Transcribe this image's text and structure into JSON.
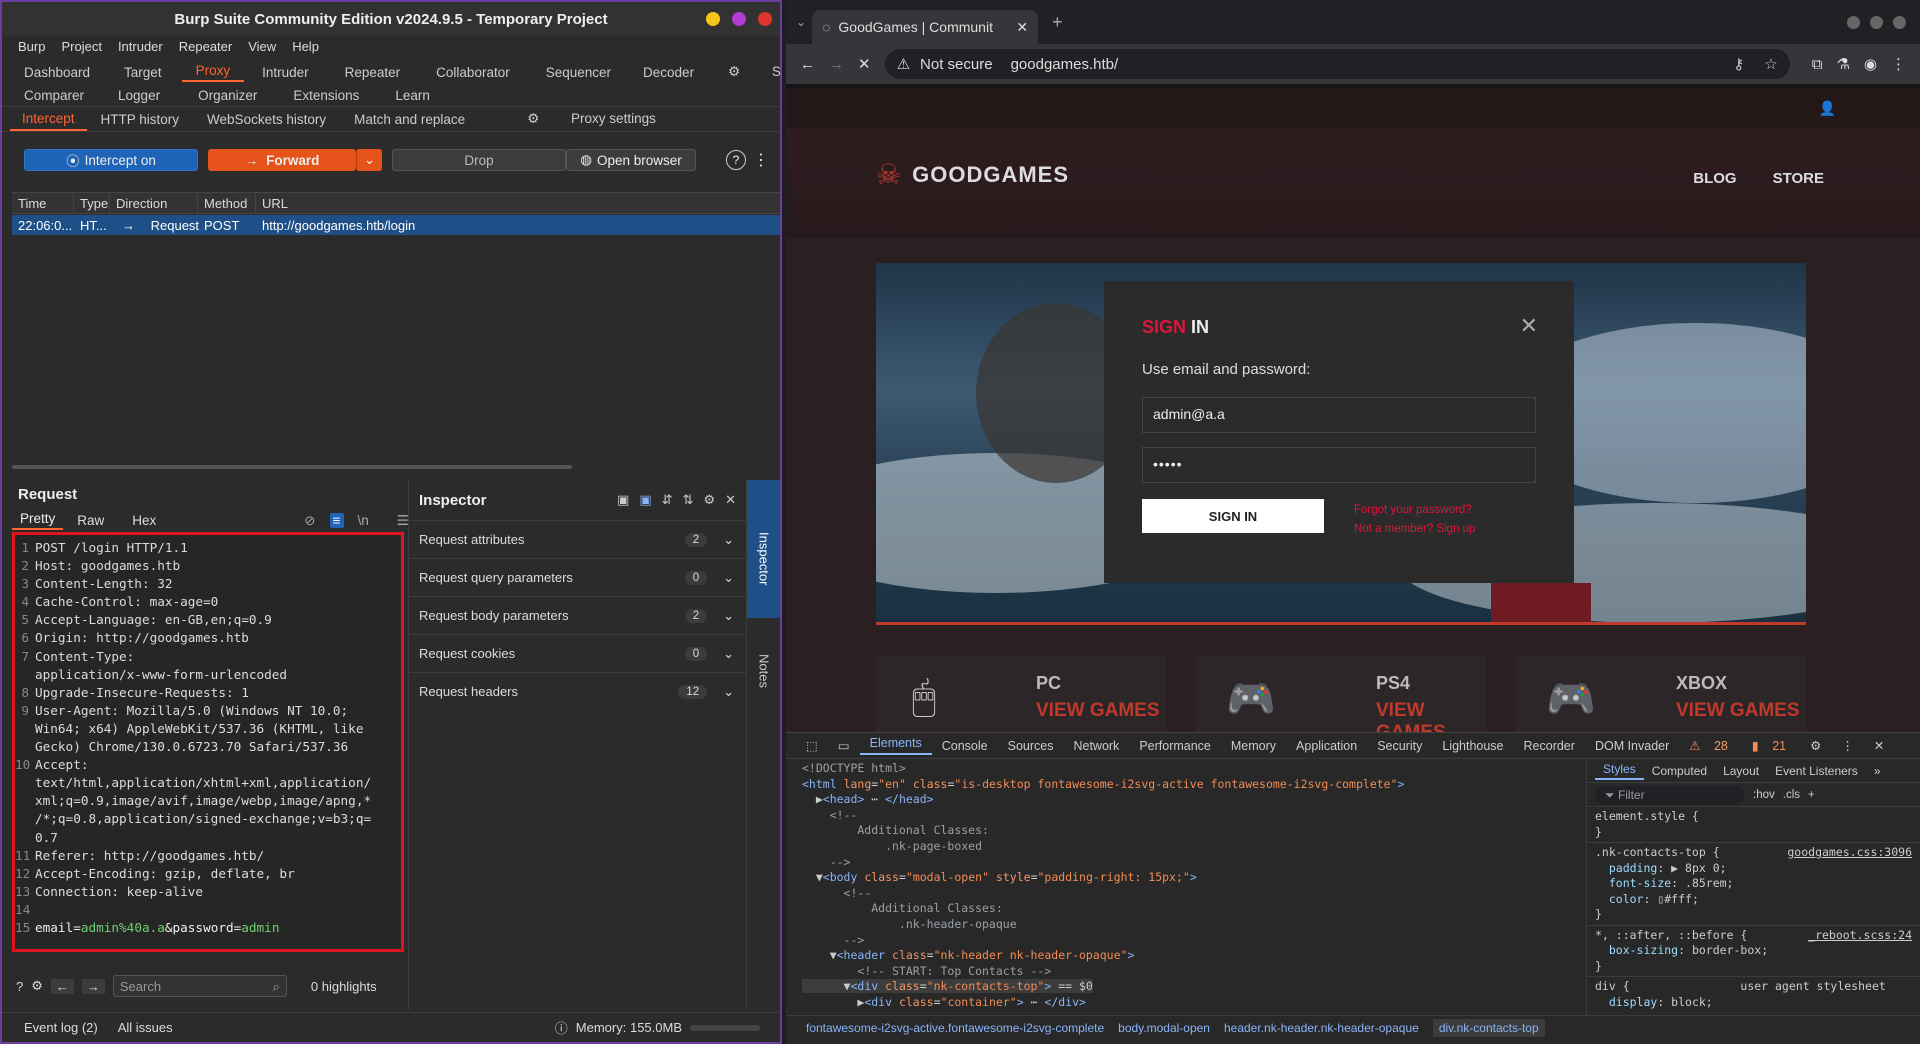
{
  "burp": {
    "title": "Burp Suite Community Edition v2024.9.5 - Temporary Project",
    "menu": [
      "Burp",
      "Project",
      "Intruder",
      "Repeater",
      "View",
      "Help"
    ],
    "tabs_row1": [
      "Dashboard",
      "Target",
      "Proxy",
      "Intruder",
      "Repeater",
      "Collaborator",
      "Sequencer",
      "Decoder"
    ],
    "settings_label": "Settings",
    "tabs_row2": [
      "Comparer",
      "Logger",
      "Organizer",
      "Extensions",
      "Learn"
    ],
    "subtabs": [
      "Intercept",
      "HTTP history",
      "WebSockets history",
      "Match and replace"
    ],
    "proxy_settings_label": "Proxy settings",
    "intercept_label": "Intercept on",
    "forward_label": "Forward",
    "drop_label": "Drop",
    "open_browser_label": "Open browser",
    "table": {
      "headers": [
        "Time",
        "Type",
        "Direction",
        "Method",
        "URL"
      ],
      "row": {
        "time": "22:06:0...",
        "type": "HT...",
        "direction": "Request",
        "method": "POST",
        "url": "http://goodgames.htb/login"
      }
    },
    "request": {
      "title": "Request",
      "tabs": [
        "Pretty",
        "Raw",
        "Hex"
      ],
      "lines": [
        {
          "n": "1",
          "text": "POST /login HTTP/1.1"
        },
        {
          "n": "2",
          "text": "Host: goodgames.htb"
        },
        {
          "n": "3",
          "text": "Content-Length: 32"
        },
        {
          "n": "4",
          "text": "Cache-Control: max-age=0"
        },
        {
          "n": "5",
          "text": "Accept-Language: en-GB,en;q=0.9"
        },
        {
          "n": "6",
          "text": "Origin: http://goodgames.htb"
        },
        {
          "n": "7",
          "text": "Content-Type:"
        },
        {
          "n": "",
          "text": "application/x-www-form-urlencoded"
        },
        {
          "n": "8",
          "text": "Upgrade-Insecure-Requests: 1"
        },
        {
          "n": "9",
          "text": "User-Agent: Mozilla/5.0 (Windows NT 10.0;"
        },
        {
          "n": "",
          "text": "Win64; x64) AppleWebKit/537.36 (KHTML, like"
        },
        {
          "n": "",
          "text": "Gecko) Chrome/130.0.6723.70 Safari/537.36"
        },
        {
          "n": "10",
          "text": "Accept:"
        },
        {
          "n": "",
          "text": "text/html,application/xhtml+xml,application/"
        },
        {
          "n": "",
          "text": "xml;q=0.9,image/avif,image/webp,image/apng,*"
        },
        {
          "n": "",
          "text": "/*;q=0.8,application/signed-exchange;v=b3;q="
        },
        {
          "n": "",
          "text": "0.7"
        },
        {
          "n": "11",
          "text": "Referer: http://goodgames.htb/"
        },
        {
          "n": "12",
          "text": "Accept-Encoding: gzip, deflate, br"
        },
        {
          "n": "13",
          "text": "Connection: keep-alive"
        },
        {
          "n": "14",
          "text": ""
        }
      ],
      "body_line": {
        "n": "15",
        "p1": "email=",
        "v1": "admin%40a.a",
        "p2": "&password=",
        "v2": "admin"
      },
      "search_placeholder": "Search",
      "highlights": "0 highlights"
    },
    "inspector": {
      "title": "Inspector",
      "rows": [
        {
          "label": "Request attributes",
          "count": "2"
        },
        {
          "label": "Request query parameters",
          "count": "0"
        },
        {
          "label": "Request body parameters",
          "count": "2"
        },
        {
          "label": "Request cookies",
          "count": "0"
        },
        {
          "label": "Request headers",
          "count": "12"
        }
      ],
      "side_inspector": "Inspector",
      "side_notes": "Notes"
    },
    "status": {
      "event_log": "Event log (2)",
      "all_issues": "All issues",
      "memory": "Memory: 155.0MB"
    }
  },
  "chrome": {
    "tab_title": "GoodGames | Communit",
    "not_secure": "Not secure",
    "url": "goodgames.htb/",
    "site": {
      "logo": "GOODGAMES",
      "nav": [
        "BLOG",
        "STORE"
      ],
      "modal": {
        "title_a": "SIGN",
        "title_b": "IN",
        "subtitle": "Use email and password:",
        "email_value": "admin@a.a",
        "password_value": "•••••",
        "button": "SIGN IN",
        "forgot": "Forgot your password?",
        "signup": "Not a member? Sign up"
      },
      "cards": [
        {
          "name": "PC",
          "view": "VIEW GAMES"
        },
        {
          "name": "PS4",
          "view": "VIEW GAMES"
        },
        {
          "name": "XBOX",
          "view": "VIEW GAMES"
        }
      ]
    },
    "devtools": {
      "tabs": [
        "Elements",
        "Console",
        "Sources",
        "Network",
        "Performance",
        "Memory",
        "Application",
        "Security",
        "Lighthouse",
        "Recorder",
        "DOM Invader"
      ],
      "warnings": "28",
      "errors": "21",
      "styles_tabs": [
        "Styles",
        "Computed",
        "Layout",
        "Event Listeners"
      ],
      "filter_placeholder": "Filter",
      "hov": ":hov",
      "cls": ".cls",
      "breadcrumbs": [
        "fontawesome-i2svg-active.fontawesome-i2svg-complete",
        "body.modal-open",
        "header.nk-header.nk-header-opaque",
        "div.nk-contacts-top"
      ]
    }
  },
  "colors": {
    "burp_accent": "#ff6633",
    "intercept_blue": "#1e63b5",
    "site_red": "#c0392b",
    "highlight_border": "#e0141e"
  }
}
